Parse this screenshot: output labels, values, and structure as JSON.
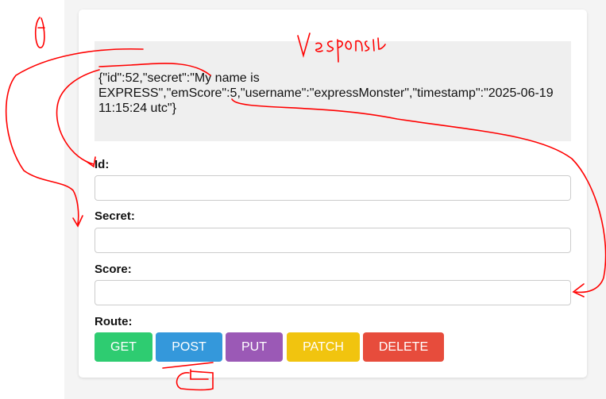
{
  "response": {
    "text": "{\"id\":52,\"secret\":\"My name is EXPRESS\",\"emScore\":5,\"username\":\"expressMonster\",\"timestamp\":\"2025-06-19 11:15:24 utc\"}"
  },
  "form": {
    "id_label": "Id:",
    "id_value": "",
    "secret_label": "Secret:",
    "secret_value": "",
    "score_label": "Score:",
    "score_value": "",
    "route_label": "Route:"
  },
  "buttons": [
    {
      "label": "GET",
      "color": "#2ecc71"
    },
    {
      "label": "POST",
      "color": "#3498db"
    },
    {
      "label": "PUT",
      "color": "#9b59b6"
    },
    {
      "label": "PATCH",
      "color": "#f1c40f"
    },
    {
      "label": "DELETE",
      "color": "#e74c3c"
    }
  ],
  "annotation": {
    "handwriting": "response",
    "color": "#ff0000"
  }
}
